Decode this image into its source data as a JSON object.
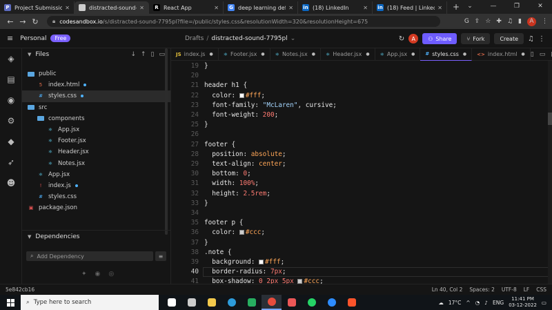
{
  "browser": {
    "tabs": [
      {
        "title": "Project Submission Fo",
        "icon_color": "#5c6bc0",
        "glyph": "P",
        "active": false
      },
      {
        "title": "distracted-sound-779",
        "icon_color": "#cccccc",
        "glyph": "",
        "active": true
      },
      {
        "title": "React App",
        "icon_color": "#000000",
        "glyph": "R",
        "active": false
      },
      {
        "title": "deep learning definiti",
        "icon_color": "#4285f4",
        "glyph": "G",
        "active": false
      },
      {
        "title": "(18) LinkedIn",
        "icon_color": "#0a66c2",
        "glyph": "in",
        "active": false
      },
      {
        "title": "(18) Feed | LinkedIn",
        "icon_color": "#0a66c2",
        "glyph": "in",
        "active": false
      }
    ],
    "new_tab": "+",
    "url_host": "codesandbox.io",
    "url_path": "/s/distracted-sound-7795pl?file=/public/styles.css&resolutionWidth=320&resolutionHeight=675",
    "profile_initial": "A"
  },
  "header": {
    "workspace": "Personal",
    "plan_badge": "Free",
    "breadcrumb_root": "Drafts",
    "breadcrumb_sep": "/",
    "sandbox_name": "distracted-sound-7795pl",
    "share_label": "Share",
    "fork_label": "Fork",
    "create_label": "Create",
    "avatar_initial": "A"
  },
  "sidebar": {
    "files_title": "Files",
    "tree": [
      {
        "name": "public",
        "type": "folder",
        "depth": 0,
        "dot": false,
        "selected": false
      },
      {
        "name": "index.html",
        "type": "html",
        "depth": 1,
        "dot": true,
        "selected": false
      },
      {
        "name": "styles.css",
        "type": "css",
        "depth": 1,
        "dot": true,
        "selected": true
      },
      {
        "name": "src",
        "type": "folder",
        "depth": 0,
        "dot": false,
        "selected": false
      },
      {
        "name": "components",
        "type": "folder",
        "depth": 1,
        "dot": false,
        "selected": false
      },
      {
        "name": "App.jsx",
        "type": "react",
        "depth": 2,
        "dot": false,
        "selected": false
      },
      {
        "name": "Footer.jsx",
        "type": "react",
        "depth": 2,
        "dot": false,
        "selected": false
      },
      {
        "name": "Header.jsx",
        "type": "react",
        "depth": 2,
        "dot": false,
        "selected": false
      },
      {
        "name": "Notes.jsx",
        "type": "react",
        "depth": 2,
        "dot": false,
        "selected": false
      },
      {
        "name": "App.jsx",
        "type": "react",
        "depth": 1,
        "dot": false,
        "selected": false
      },
      {
        "name": "index.js",
        "type": "js-error",
        "depth": 1,
        "dot": true,
        "selected": false
      },
      {
        "name": "styles.css",
        "type": "css",
        "depth": 1,
        "dot": false,
        "selected": false
      },
      {
        "name": "package.json",
        "type": "json",
        "depth": 0,
        "dot": false,
        "selected": false
      }
    ],
    "dependencies_title": "Dependencies",
    "add_dependency_placeholder": "Add Dependency"
  },
  "editor": {
    "tabs": [
      {
        "label": "index.js",
        "icon": "JS",
        "icon_color": "#e8c33b",
        "active": false
      },
      {
        "label": "Footer.jsx",
        "icon": "⚛",
        "icon_color": "#61dafb",
        "active": false
      },
      {
        "label": "Notes.jsx",
        "icon": "⚛",
        "icon_color": "#61dafb",
        "active": false
      },
      {
        "label": "Header.jsx",
        "icon": "⚛",
        "icon_color": "#61dafb",
        "active": false
      },
      {
        "label": "App.jsx",
        "icon": "⚛",
        "icon_color": "#61dafb",
        "active": false
      },
      {
        "label": "styles.css",
        "icon": "#",
        "icon_color": "#4fb3ff",
        "active": true
      },
      {
        "label": "index.html",
        "icon": "<>",
        "icon_color": "#e06c4b",
        "active": false
      }
    ],
    "current_line": "40",
    "lines": [
      {
        "n": "19",
        "t": "}"
      },
      {
        "n": "20",
        "t": ""
      },
      {
        "n": "21",
        "t": "header h1 {"
      },
      {
        "n": "22",
        "t": "  color: ",
        "sw": "#ffffff",
        "v": "#fff",
        "end": ";"
      },
      {
        "n": "23",
        "t": "  font-family: ",
        "s": "\"McLaren\"",
        "v2": ", cursive",
        "end": ";"
      },
      {
        "n": "24",
        "t": "  font-weight: ",
        "num": "200",
        "end": ";"
      },
      {
        "n": "25",
        "t": "}"
      },
      {
        "n": "26",
        "t": ""
      },
      {
        "n": "27",
        "t": "footer {"
      },
      {
        "n": "28",
        "t": "  position: ",
        "v": "absolute",
        "end": ";"
      },
      {
        "n": "29",
        "t": "  text-align: ",
        "v": "center",
        "end": ";"
      },
      {
        "n": "30",
        "t": "  bottom: ",
        "num": "0",
        "end": ";"
      },
      {
        "n": "31",
        "t": "  width: ",
        "num": "100%",
        "end": ";"
      },
      {
        "n": "32",
        "t": "  height: ",
        "num": "2.5rem",
        "end": ";"
      },
      {
        "n": "33",
        "t": "}"
      },
      {
        "n": "34",
        "t": ""
      },
      {
        "n": "35",
        "t": "footer p {"
      },
      {
        "n": "36",
        "t": "  color: ",
        "sw": "#cccccc",
        "v": "#ccc",
        "end": ";"
      },
      {
        "n": "37",
        "t": "}"
      },
      {
        "n": "38",
        "t": ".note {"
      },
      {
        "n": "39",
        "t": "  background: ",
        "sw": "#ffffff",
        "v": "#fff",
        "end": ";"
      },
      {
        "n": "40",
        "t": "  border-radius: ",
        "num": "7px",
        "end": ";"
      },
      {
        "n": "41",
        "t": "  box-shadow: ",
        "num": "0 2px 5px ",
        "sw": "#cccccc",
        "v": "#ccc",
        "end": ";"
      }
    ]
  },
  "status": {
    "commit": "5e842cb16",
    "position": "Ln 40, Col 2",
    "spaces": "Spaces: 2",
    "encoding": "UTF-8",
    "eol": "LF",
    "language": "CSS"
  },
  "taskbar": {
    "search_placeholder": "Type here to search",
    "apps": [
      {
        "name": "task-view",
        "color": "#ffffff",
        "active": false
      },
      {
        "name": "widgets",
        "color": "#cccccc",
        "active": false
      },
      {
        "name": "file-explorer",
        "color": "#f2c94c",
        "active": false
      },
      {
        "name": "edge",
        "color": "#2d9cdb",
        "active": false
      },
      {
        "name": "store",
        "color": "#27ae60",
        "active": false
      },
      {
        "name": "chrome",
        "color": "#e74c3c",
        "active": true
      },
      {
        "name": "media",
        "color": "#eb5757",
        "active": false
      },
      {
        "name": "whatsapp",
        "color": "#25d366",
        "active": false
      },
      {
        "name": "zoom",
        "color": "#2d8cff",
        "active": false
      },
      {
        "name": "brave",
        "color": "#fb542b",
        "active": false
      }
    ],
    "temperature": "17°C",
    "language": "ENG",
    "time": "11:41 PM",
    "date": "03-12-2022"
  }
}
